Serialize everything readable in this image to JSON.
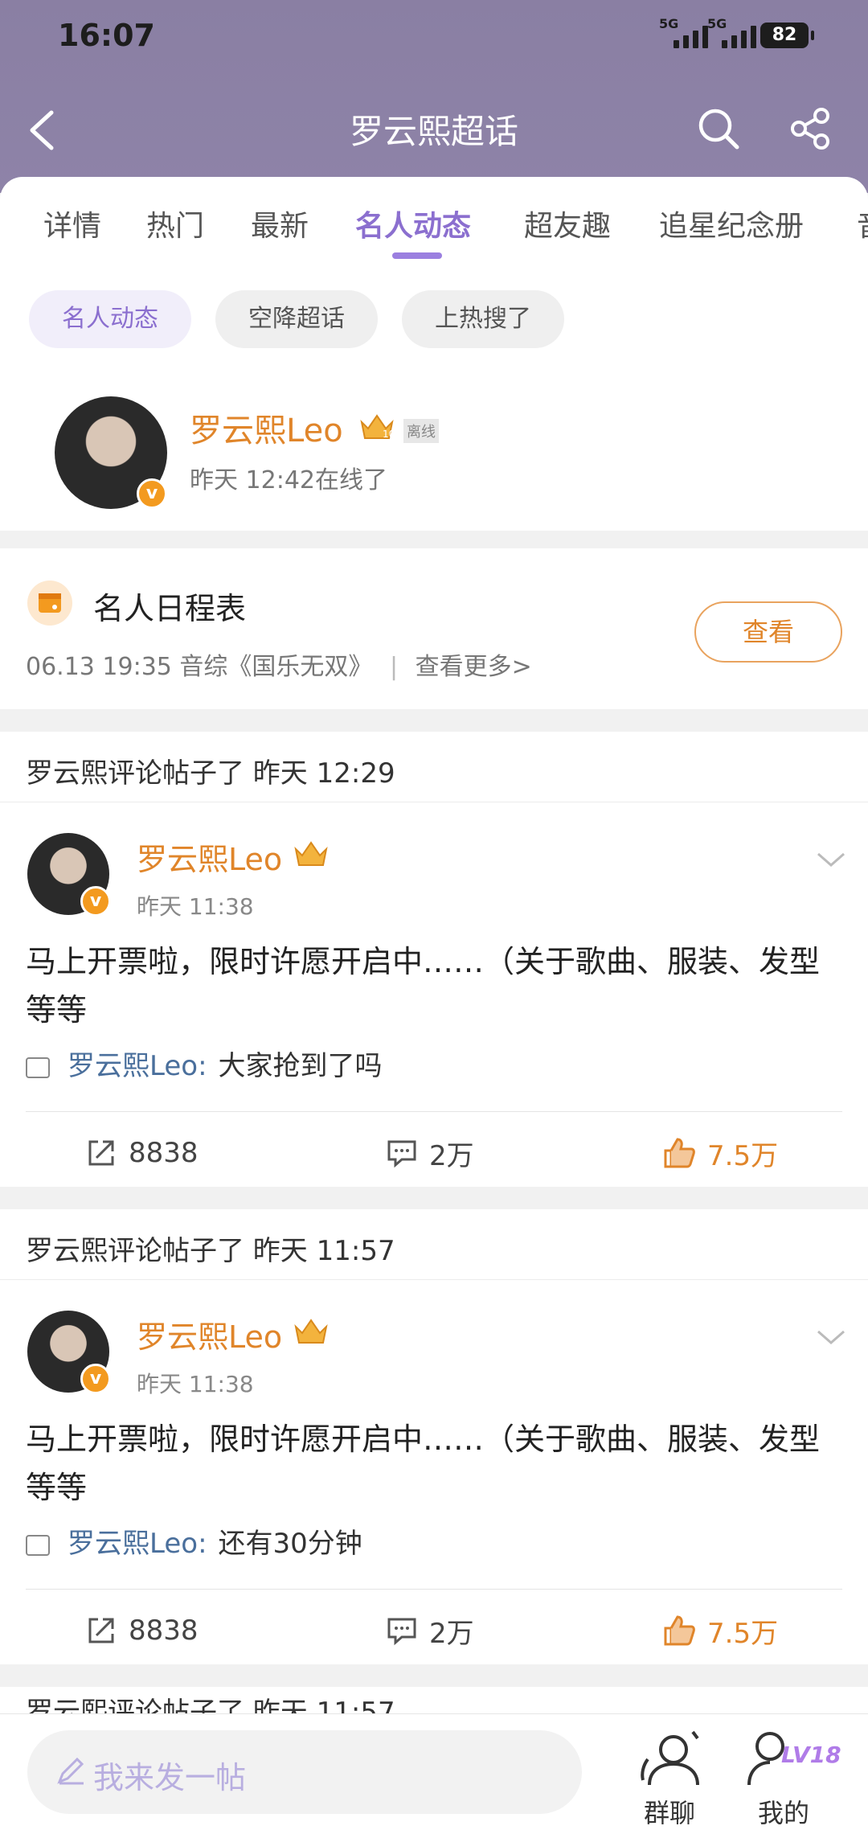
{
  "status_bar": {
    "time": "16:07",
    "network": "5G",
    "battery": "82"
  },
  "nav": {
    "title": "罗云熙超话"
  },
  "tabs": [
    "详情",
    "热门",
    "最新",
    "名人动态",
    "超友趣",
    "追星纪念册",
    "音"
  ],
  "active_tab": "名人动态",
  "chips": [
    "名人动态",
    "空降超话",
    "上热搜了"
  ],
  "celebrity": {
    "name": "罗云熙Leo",
    "level_badge": "10",
    "offline_tag": "离线",
    "status": "昨天 12:42在线了",
    "verified": "v"
  },
  "schedule": {
    "title": "名人日程表",
    "detail": "06.13 19:35 音综《国乐无双》",
    "more": "查看更多>",
    "button": "查看"
  },
  "posts": [
    {
      "header": "罗云熙评论帖子了 昨天 12:29",
      "author": "罗云熙Leo",
      "time": "昨天 11:38",
      "text": "马上开票啦，限时许愿开启中……（关于歌曲、服装、发型等等",
      "reply_name": "罗云熙Leo:",
      "reply_text": "大家抢到了吗",
      "reposts": "8838",
      "comments": "2万",
      "likes": "7.5万"
    },
    {
      "header": "罗云熙评论帖子了 昨天 11:57",
      "author": "罗云熙Leo",
      "time": "昨天 11:38",
      "text": "马上开票啦，限时许愿开启中……（关于歌曲、服装、发型等等",
      "reply_name": "罗云熙Leo:",
      "reply_text": "还有30分钟",
      "reposts": "8838",
      "comments": "2万",
      "likes": "7.5万"
    }
  ],
  "bottom_bar": {
    "compose_placeholder": "我来发一帖",
    "group_chat": "群聊",
    "mine": "我的",
    "level": "LV18"
  },
  "colors": {
    "accent_purple": "#8b6fcf",
    "brand_orange": "#e0852a",
    "header_bg": "#8e83a8"
  }
}
